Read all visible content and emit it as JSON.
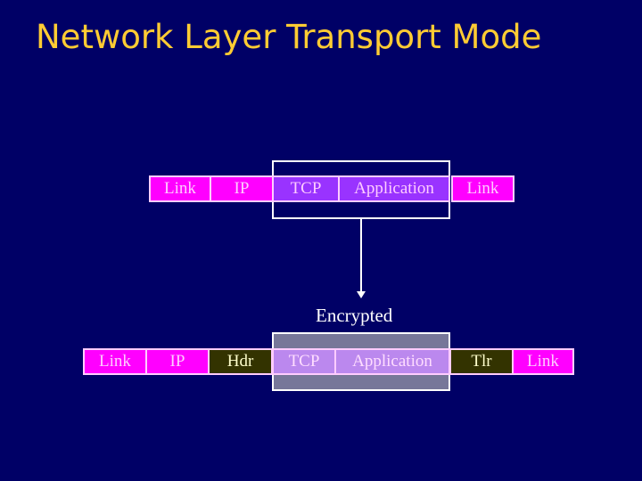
{
  "title": "Network Layer Transport Mode",
  "top_row": {
    "cells": [
      {
        "label": "Link",
        "color": "#ff00ff"
      },
      {
        "label": "IP",
        "color": "#ff00ff"
      },
      {
        "label": "TCP",
        "color": "#9933ff"
      },
      {
        "label": "Application",
        "color": "#9933ff"
      },
      {
        "label": "Link",
        "color": "#ff00ff"
      }
    ]
  },
  "arrow_label": "Encrypted",
  "bottom_row": {
    "cells": [
      {
        "label": "Link",
        "color": "#ff00ff"
      },
      {
        "label": "IP",
        "color": "#ff00ff"
      },
      {
        "label": "Hdr",
        "color": "#333300"
      },
      {
        "label": "TCP",
        "color": "#bb88ee"
      },
      {
        "label": "Application",
        "color": "#bb88ee"
      },
      {
        "label": "Tlr",
        "color": "#333300"
      },
      {
        "label": "Link",
        "color": "#ff00ff"
      }
    ]
  },
  "colors": {
    "background": "#000066",
    "title": "#ffcc33",
    "encrypted_region": "#777799"
  }
}
